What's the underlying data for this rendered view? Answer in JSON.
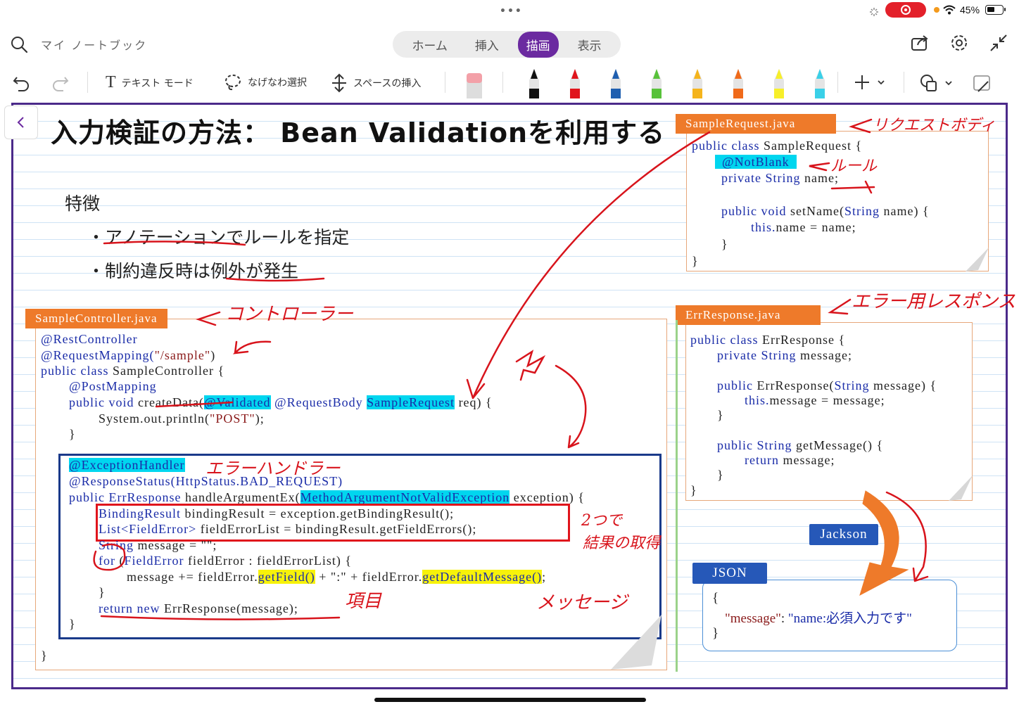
{
  "status_bar": {
    "dots": "•••",
    "battery": "45%"
  },
  "header": {
    "notebook_title": "マイ ノートブック",
    "tabs": [
      {
        "label": "ホーム",
        "active": false
      },
      {
        "label": "挿入",
        "active": false
      },
      {
        "label": "描画",
        "active": true
      },
      {
        "label": "表示",
        "active": false
      }
    ],
    "accent_color": "#6b2aa0"
  },
  "toolbar": {
    "text_mode": "テキスト モード",
    "lasso": "なげなわ選択",
    "insert_space": "スペースの挿入",
    "pens": [
      {
        "color": "#111111"
      },
      {
        "color": "#e0141c"
      },
      {
        "color": "#1f5fb0"
      },
      {
        "color": "#58c23a"
      },
      {
        "color": "#f5b41c"
      },
      {
        "color": "#f06a1a"
      },
      {
        "color": "#f7ef2a"
      },
      {
        "color": "#3ad0e8"
      }
    ]
  },
  "page": {
    "title": "入力検証の方法： Bean Validationを利用する",
    "features_heading": "特徴",
    "features": [
      "・アノテーションでルールを指定",
      "・制約違反時は例外が発生"
    ]
  },
  "controller": {
    "filename": "SampleController.java",
    "lines": {
      "l1": "@RestController",
      "l2a": "@RequestMapping(",
      "l2b": "\"/sample\"",
      "l2c": ")",
      "l3a": "public class ",
      "l3b": "SampleController {",
      "l4": "@PostMapping",
      "l5a": "public void ",
      "l5b": "createData(",
      "l5c": "@Validated",
      "l5d": " @RequestBody ",
      "l5e": "SampleRequest",
      "l5f": " req) {",
      "l6a": "System.out.println(",
      "l6b": "\"POST\"",
      "l6c": ");",
      "l7": "}",
      "l8": "}"
    },
    "handler": {
      "l1": "@ExceptionHandler",
      "l2": "@ResponseStatus(HttpStatus.BAD_REQUEST)",
      "l3a": "public ErrResponse ",
      "l3b": "handleArgumentEx(",
      "l3c": "MethodArgumentNotValidException",
      "l3d": " exception) {",
      "l4a": "BindingResult",
      "l4b": " bindingResult = exception.getBindingResult();",
      "l5a": "List<FieldError>",
      "l5b": " fieldErrorList = bindingResult.getFieldErrors();",
      "l6a": "String",
      "l6b": " message = \"\";",
      "l7a": "for",
      "l7b": " (",
      "l7c": "FieldError",
      "l7d": " fieldError : fieldErrorList) {",
      "l8a": "message += fieldError.",
      "l8b": "getField()",
      "l8c": " + \":\" + fieldError.",
      "l8d": "getDefaultMessage()",
      "l8e": ";",
      "l9": "}",
      "l10a": "return new ",
      "l10b": "ErrResponse(message);",
      "l11": "}"
    }
  },
  "request": {
    "filename": "SampleRequest.java",
    "l1a": "public class ",
    "l1b": "SampleRequest {",
    "l2": "@NotBlank",
    "l3a": "private String ",
    "l3b": "name;",
    "l4a": "public void ",
    "l4b": "setName(",
    "l4c": "String",
    "l4d": " name) {",
    "l5a": "this.",
    "l5b": "name = name;",
    "l6": "}",
    "l7": "}"
  },
  "errresponse": {
    "filename": "ErrResponse.java",
    "l1a": "public class ",
    "l1b": "ErrResponse {",
    "l2a": "private String ",
    "l2b": "message;",
    "l3a": "public ",
    "l3b": "ErrResponse(",
    "l3c": "String",
    "l3d": " message) {",
    "l4a": "this.",
    "l4b": "message = message;",
    "l5": "}",
    "l6a": "public String ",
    "l6b": "getMessage() {",
    "l7a": "return ",
    "l7b": "message;",
    "l8": "}",
    "l9": "}"
  },
  "jackson_label": "Jackson",
  "json": {
    "label": "JSON",
    "open": "{",
    "key": "\"message\"",
    "colon": ": ",
    "value": "\"name:必須入力です\"",
    "close": "}"
  },
  "annotations": {
    "request_body": "リクエストボディ",
    "rule": "ルール",
    "controller": "コントローラー",
    "error_response": "エラー用レスポンス",
    "error_handler": "エラーハンドラー",
    "two_results": "2つで",
    "results_get": "結果の取得",
    "field": "項目",
    "message": "メッセージ"
  }
}
